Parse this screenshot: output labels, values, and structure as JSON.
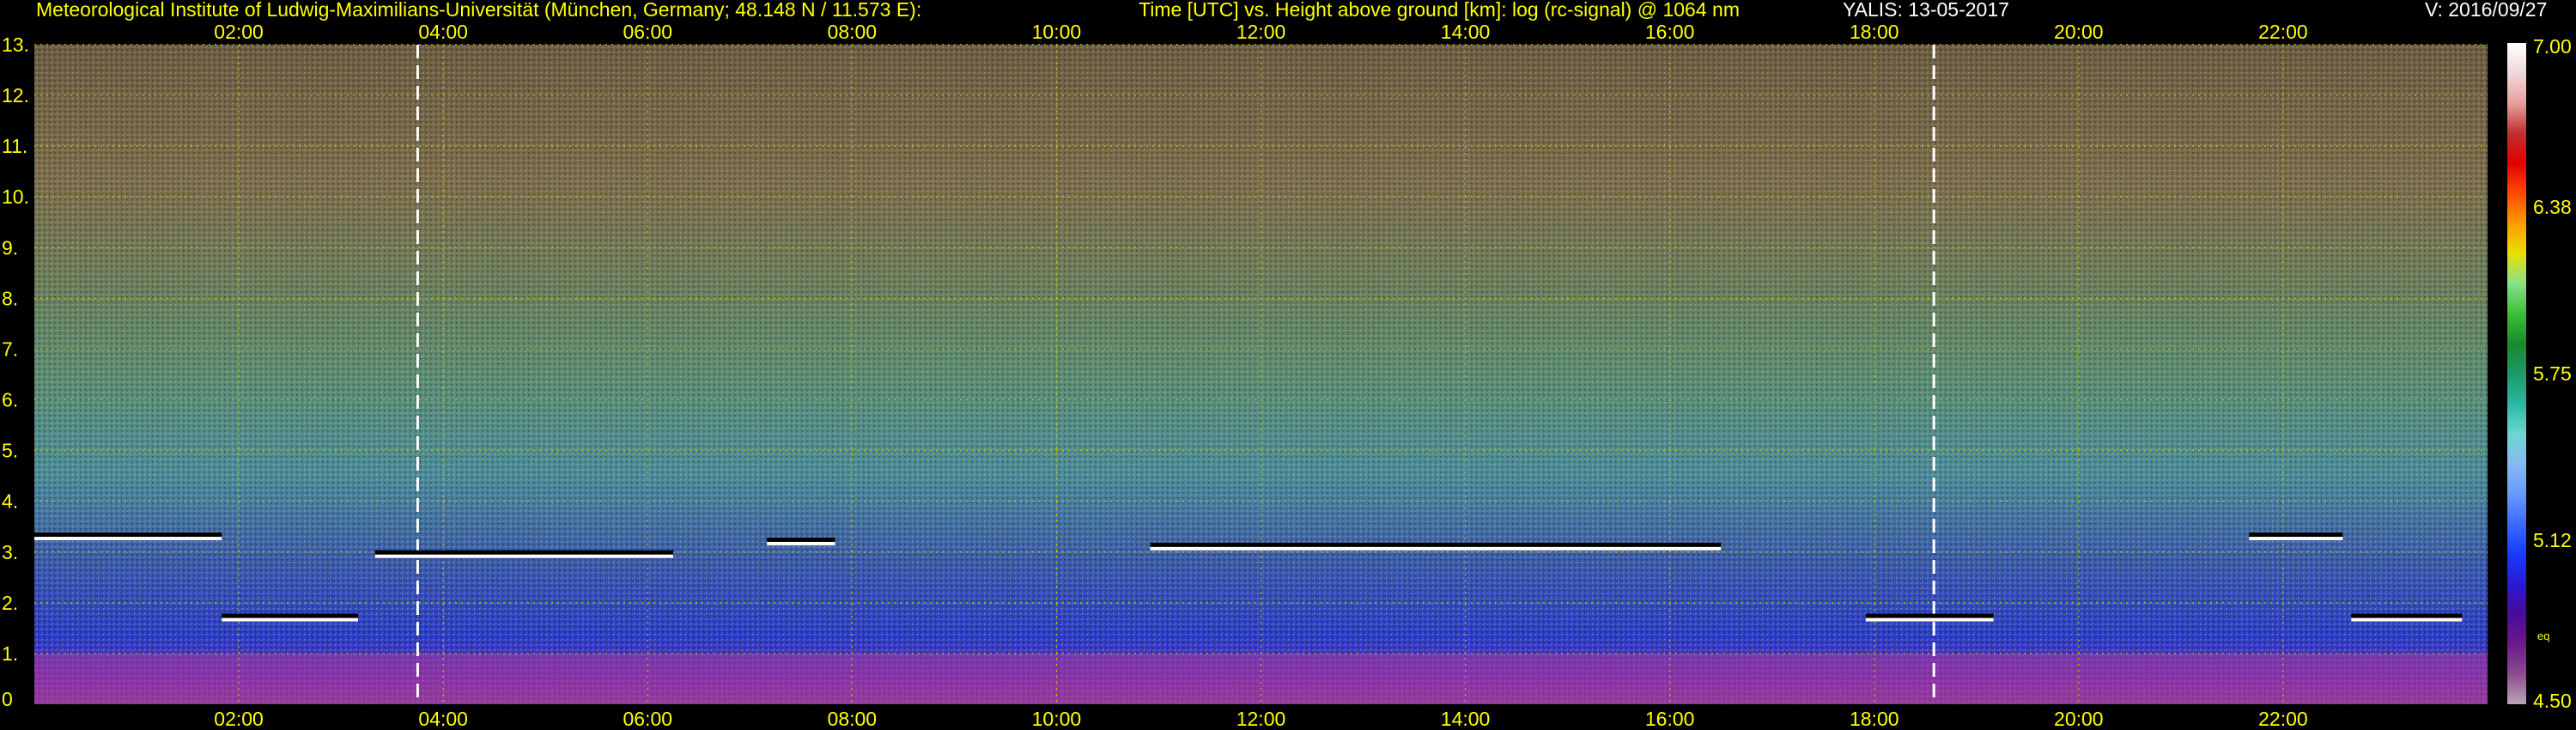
{
  "header": {
    "institute": "Meteorological Institute of Ludwig-Maximilians-Universität (München, Germany; 48.148 N / 11.573 E):",
    "description": "Time [UTC] vs. Height above ground [km]: log (rc-signal) @ 1064 nm",
    "instrument_date": "YALIS: 13-05-2017",
    "version": "V: 2016/09/27"
  },
  "colors": {
    "background": "#000000",
    "annotation": "#ffff00",
    "grid": "#c8c800",
    "marker": "#ffffff"
  },
  "chart_data": {
    "type": "heatmap",
    "title": "Time [UTC] vs. Height above ground [km]: log (rc-signal) @ 1064 nm",
    "xlabel": "Time [UTC]",
    "ylabel": "Height above ground [km]",
    "xlim": [
      "00:00",
      "24:00"
    ],
    "ylim": [
      0,
      13
    ],
    "x_ticks": [
      "02:00",
      "04:00",
      "06:00",
      "08:00",
      "10:00",
      "12:00",
      "14:00",
      "16:00",
      "18:00",
      "20:00",
      "22:00"
    ],
    "y_ticks": [
      "0",
      "1.",
      "2.",
      "3.",
      "4.",
      "5.",
      "6.",
      "7.",
      "8.",
      "9.",
      "10.",
      "11.",
      "12.",
      "13."
    ],
    "grid": true,
    "colorbar": {
      "min": 4.5,
      "max": 7.0,
      "tick_labels": [
        "7.00",
        "6.38",
        "5.75",
        "5.12",
        "4.50"
      ],
      "tick_values": [
        7.0,
        6.38,
        5.75,
        5.12,
        4.5
      ],
      "unit_label": "eq",
      "colormap": [
        "#b8a8b8",
        "#8c4c8c",
        "#6a1a8a",
        "#4a0a9a",
        "#2a1ad0",
        "#1a3aff",
        "#3a6aff",
        "#6a9aff",
        "#8ab8f0",
        "#6ad8d0",
        "#2ab8a0",
        "#1a9a6a",
        "#1a8a2a",
        "#3ac03a",
        "#8ae08a",
        "#e8e000",
        "#ff9a00",
        "#ff4a00",
        "#e00000",
        "#c03030",
        "#e8a0a0",
        "#f0d8d8",
        "#ffffff"
      ]
    },
    "markers": [
      {
        "time": "03:45",
        "label": "dashed white line"
      },
      {
        "time": "18:35",
        "label": "dashed white line"
      }
    ],
    "cloud_layer_km": [
      {
        "start": "00:00",
        "end": "01:50",
        "height": 3.3
      },
      {
        "start": "01:50",
        "end": "03:10",
        "height": 1.7
      },
      {
        "start": "03:20",
        "end": "06:15",
        "height": 2.95
      },
      {
        "start": "07:10",
        "end": "07:50",
        "height": 3.2
      },
      {
        "start": "10:55",
        "end": "16:30",
        "height": 3.1
      },
      {
        "start": "17:55",
        "end": "19:10",
        "height": 1.7
      },
      {
        "start": "21:40",
        "end": "22:35",
        "height": 3.3
      },
      {
        "start": "22:40",
        "end": "23:45",
        "height": 1.7
      }
    ]
  }
}
